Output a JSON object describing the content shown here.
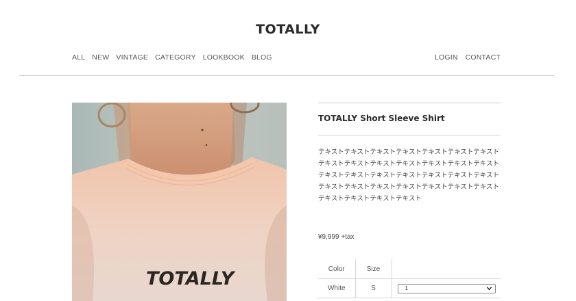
{
  "brand": {
    "name": "TOTALLY"
  },
  "nav": {
    "left": [
      "ALL",
      "NEW",
      "VINTAGE",
      "CATEGORY",
      "LOOKBOOK",
      "BLOG"
    ],
    "right": [
      "LOGIN",
      "CONTACT"
    ]
  },
  "product": {
    "title": "TOTALLY Short Sleeve Shirt",
    "description": "テキストテキストテキストテキストテキストテキストテキストテキストテキストテキストテキストテキストテキストテキストテキストテキストテキストテキストテキストテキストテキストテキストテキストテキストテキストテキストテキストテキストテキストテキストテキストテキスト",
    "price": "¥9,999 +tax",
    "image_text": "TOTALLY"
  },
  "variants": {
    "headers": {
      "color": "Color",
      "size": "Size"
    },
    "rows": [
      {
        "color": "White",
        "size": "S",
        "quantity": "1"
      }
    ]
  },
  "icons": {
    "select_arrow": "chevron-down-icon"
  }
}
